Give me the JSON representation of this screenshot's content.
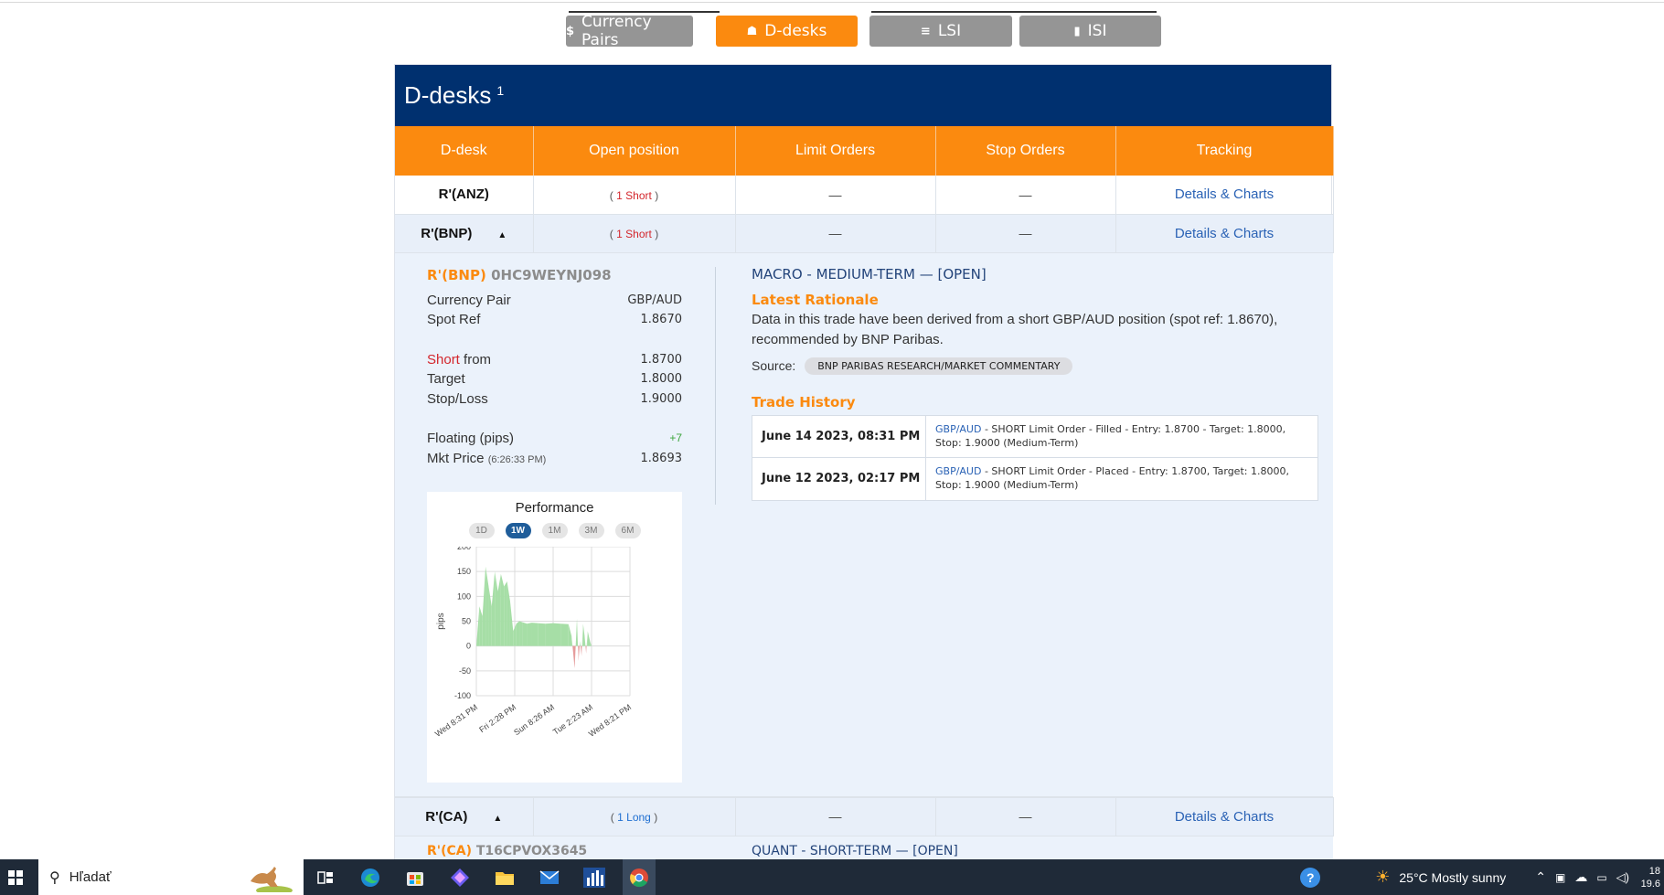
{
  "nav": {
    "tabs": [
      {
        "label": "Currency Pairs",
        "icon": "$",
        "active": false
      },
      {
        "label": "D-desks",
        "icon": "☗",
        "active": true
      },
      {
        "label": "LSI",
        "icon": "≡",
        "active": false
      },
      {
        "label": "ISI",
        "icon": "▮",
        "active": false
      }
    ]
  },
  "panel": {
    "title": "D-desks",
    "title_sup": "1",
    "columns": [
      "D-desk",
      "Open position",
      "Limit Orders",
      "Stop Orders",
      "Tracking"
    ],
    "rows": [
      {
        "desk": "R'(ANZ)",
        "position_count": "1",
        "position_side": "Short",
        "limit": "—",
        "stop": "—",
        "tracking": "Details & Charts"
      },
      {
        "desk": "R'(BNP)",
        "position_count": "1",
        "position_side": "Short",
        "limit": "—",
        "stop": "—",
        "tracking": "Details & Charts"
      },
      {
        "desk": "R'(CA)",
        "position_count": "1",
        "position_side": "Long",
        "limit": "—",
        "stop": "—",
        "tracking": "Details & Charts"
      }
    ]
  },
  "detail": {
    "desk_name": "R'(BNP)",
    "desk_code": "0HC9WEYNJ098",
    "currency_pair_label": "Currency Pair",
    "currency_pair": "GBP/AUD",
    "spot_ref_label": "Spot Ref",
    "spot_ref": "1.8670",
    "short_label": "Short",
    "from_label": " from",
    "short_from": "1.8700",
    "target_label": "Target",
    "target": "1.8000",
    "stoploss_label": "Stop/Loss",
    "stoploss": "1.9000",
    "floating_label": "Floating (pips)",
    "floating": "+7",
    "mkt_price_label": "Mkt Price",
    "mkt_price_time": "(6:26:33 PM)",
    "mkt_price": "1.8693",
    "macro": "MACRO - MEDIUM-TERM — [OPEN]",
    "rationale_title": "Latest Rationale",
    "rationale": "Data in this trade have been derived from a short GBP/AUD position (spot ref: 1.8670), recommended by BNP Paribas.",
    "source_label": "Source:",
    "source": "BNP PARIBAS RESEARCH/MARKET COMMENTARY",
    "history_title": "Trade History",
    "history": [
      {
        "date": "June 14 2023, 08:31 PM",
        "pair": "GBP/AUD",
        "text": " - SHORT Limit Order - Filled - Entry: 1.8700 - Target: 1.8000, Stop: 1.9000 (Medium-Term)"
      },
      {
        "date": "June 12 2023, 02:17 PM",
        "pair": "GBP/AUD",
        "text": " - SHORT Limit Order - Placed - Entry: 1.8700, Target: 1.8000, Stop: 1.9000 (Medium-Term)"
      }
    ]
  },
  "chart_data": {
    "type": "area",
    "title": "Performance",
    "ranges": [
      "1D",
      "1W",
      "1M",
      "3M",
      "6M"
    ],
    "selected_range": "1W",
    "ylabel": "pips",
    "ylim": [
      -100,
      200
    ],
    "yticks": [
      200,
      150,
      100,
      50,
      0,
      -50,
      -100
    ],
    "xticks": [
      "Wed 8:31 PM",
      "Fri 2:28 PM",
      "Sun 8:26 AM",
      "Tue 2:23 AM",
      "Wed 8:21 PM"
    ],
    "grid": true,
    "positive_color": "#a6dea6",
    "negative_color": "#e59a9a",
    "x": [
      0,
      0.02,
      0.04,
      0.06,
      0.08,
      0.1,
      0.12,
      0.14,
      0.16,
      0.18,
      0.2,
      0.22,
      0.24,
      0.26,
      0.28,
      0.3,
      0.33,
      0.36,
      0.4,
      0.45,
      0.5,
      0.55,
      0.6,
      0.62,
      0.64,
      0.655,
      0.665,
      0.675,
      0.685,
      0.695,
      0.705,
      0.715,
      0.725,
      0.74,
      0.75
    ],
    "values": [
      0,
      80,
      60,
      160,
      120,
      80,
      150,
      110,
      145,
      120,
      130,
      90,
      30,
      45,
      50,
      48,
      45,
      47,
      46,
      45,
      46,
      45,
      44,
      20,
      -45,
      55,
      -30,
      10,
      -20,
      45,
      20,
      -15,
      30,
      10,
      0
    ]
  },
  "next_detail": {
    "desk_name": "R'(CA)",
    "desk_code": "T16CPVOX3645",
    "macro": "QUANT - SHORT-TERM — [OPEN]"
  },
  "taskbar": {
    "search_placeholder": "Hľadať",
    "weather": "25°C  Mostly sunny",
    "clock_time": "18",
    "clock_date": "19.6"
  }
}
